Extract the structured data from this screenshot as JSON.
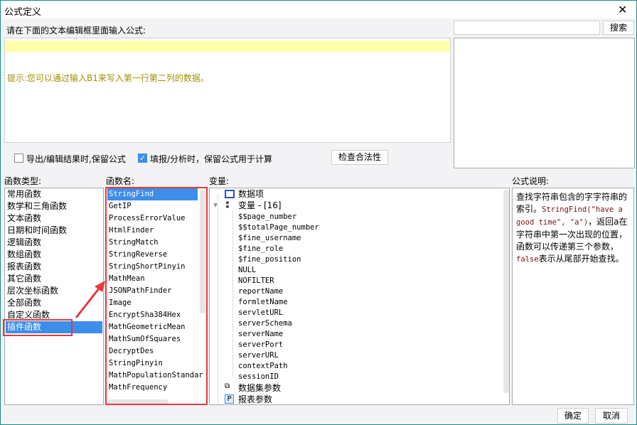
{
  "window": {
    "title": "公式定义"
  },
  "editor": {
    "label": "请在下面的文本编辑框里面输入公式:",
    "value": "",
    "hint": "提示:您可以通过输入B1来写入第一行第二列的数据。"
  },
  "search": {
    "placeholder": "",
    "value": "",
    "button": "搜索"
  },
  "options": {
    "keep_formula_export": {
      "label": "导出/编辑结果时,保留公式",
      "checked": false
    },
    "keep_formula_fill": {
      "label": "填报/分析时，保留公式用于计算",
      "checked": true
    },
    "check_button": "检查合法性"
  },
  "categories": {
    "label": "函数类型:",
    "items": [
      "常用函数",
      "数学和三角函数",
      "文本函数",
      "日期和时间函数",
      "逻辑函数",
      "数组函数",
      "报表函数",
      "其它函数",
      "层次坐标函数",
      "全部函数",
      "自定义函数",
      "插件函数"
    ],
    "selected": "插件函数"
  },
  "functions": {
    "label": "函数名:",
    "items": [
      "StringFind",
      "GetIP",
      "ProcessErrorValue",
      "HtmlFinder",
      "StringMatch",
      "StringReverse",
      "StringShortPinyin",
      "MathMean",
      "JSONPathFinder",
      "Image",
      "EncryptSha384Hex",
      "MathGeometricMean",
      "MathSumOfSquares",
      "DecryptDes",
      "StringPinyin",
      "MathPopulationStandar",
      "MathFrequency"
    ],
    "selected": "StringFind"
  },
  "variables": {
    "label": "变量:",
    "data_items": "数据项",
    "group": "变量 - [16]",
    "items": [
      "$$page_number",
      "$$totalPage_number",
      "$fine_username",
      "$fine_role",
      "$fine_position",
      "NULL",
      "NOFILTER",
      "reportName",
      "formletName",
      "servletURL",
      "serverSchema",
      "serverName",
      "serverPort",
      "serverURL",
      "contextPath",
      "sessionID"
    ],
    "dataset_params": "数据集参数",
    "report_params": "报表参数"
  },
  "description": {
    "label": "公式说明:",
    "parts": [
      {
        "t": "查找字符串包含的字字符串的索引。",
        "code": false
      },
      {
        "t": "StringFind(\"have a good time\", \"a\")",
        "code": true
      },
      {
        "t": "，返回a在字符串中第一次出现的位置，函数可以传递第三个参数，",
        "code": false
      },
      {
        "t": "false",
        "code": true
      },
      {
        "t": "表示从尾部开始查找。",
        "code": false
      }
    ]
  },
  "footer": {
    "ok": "确定",
    "cancel": "取消"
  },
  "colors": {
    "selection": "#3d8ee8",
    "highlight_box": "#e8383d",
    "hint_text": "#a09000",
    "editor_line": "#ffffaa"
  }
}
